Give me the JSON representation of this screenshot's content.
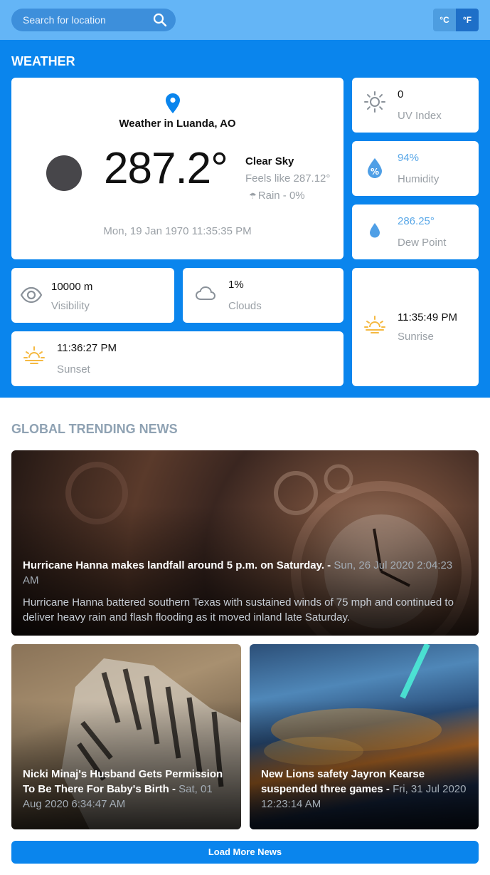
{
  "search": {
    "placeholder": "Search for location",
    "icon": "search-icon"
  },
  "units": {
    "celsius": "°C",
    "fahrenheit": "°F",
    "selected": "°F"
  },
  "weather": {
    "section_title": "WEATHER",
    "location": "Weather in Luanda, AO",
    "temperature": "287.2°",
    "condition": "Clear Sky",
    "feels_like": "Feels like 287.12°",
    "rain": "Rain - 0%",
    "datetime": "Mon, 19 Jan 1970 11:35:35 PM",
    "uv": {
      "value": "0",
      "label": "UV Index"
    },
    "humidity": {
      "value": "94%",
      "label": "Humidity"
    },
    "dew_point": {
      "value": "286.25°",
      "label": "Dew Point"
    },
    "visibility": {
      "value": "10000 m",
      "label": "Visibility"
    },
    "clouds": {
      "value": "1%",
      "label": "Clouds"
    },
    "sunrise": {
      "value": "11:35:49 PM",
      "label": "Sunrise"
    },
    "sunset": {
      "value": "11:36:27 PM",
      "label": "Sunset"
    }
  },
  "news": {
    "section_title": "GLOBAL TRENDING NEWS",
    "articles": [
      {
        "headline": "Hurricane Hanna makes landfall around 5 p.m. on Saturday.",
        "date": "Sun, 26 Jul 2020 2:04:23 AM",
        "description": "Hurricane Hanna battered southern Texas with sustained winds of 75 mph and continued to deliver heavy rain and flash flooding as it moved inland late Saturday."
      },
      {
        "headline": "Nicki Minaj's Husband Gets Permission To Be There For Baby's Birth",
        "date": "Sat, 01 Aug 2020 6:34:47 AM"
      },
      {
        "headline": "New Lions safety Jayron Kearse suspended three games",
        "date": "Fri, 31 Jul 2020 12:23:14 AM"
      }
    ],
    "load_more": "Load More News"
  },
  "colors": {
    "header": "#64b5f6",
    "primary": "#0a85ed",
    "muted": "#9aa0a6"
  }
}
